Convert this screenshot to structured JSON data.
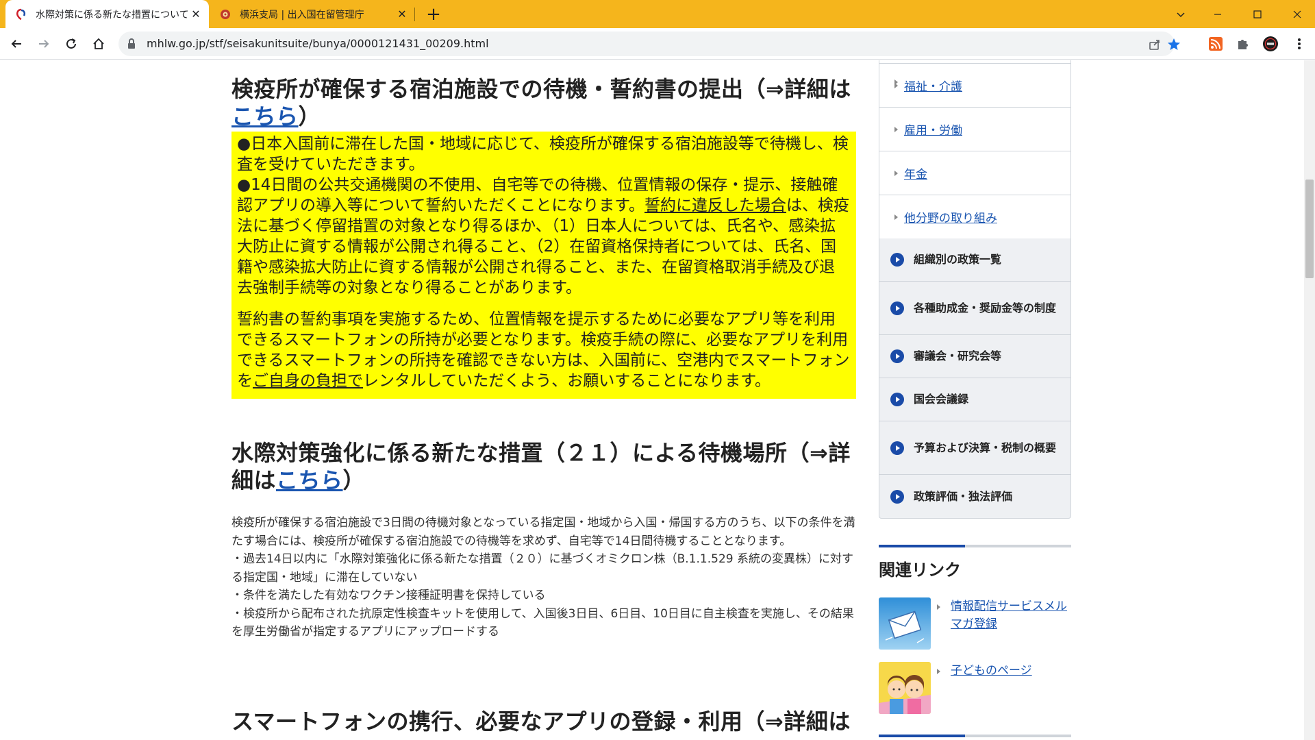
{
  "browser": {
    "tabs": [
      {
        "title": "水際対策に係る新たな措置について",
        "active": true
      },
      {
        "title": "横浜支局 | 出入国在留管理庁",
        "active": false
      }
    ],
    "close_glyph": "✕",
    "new_tab_glyph": "+",
    "url": "mhlw.go.jp/stf/seisakunitsuite/bunya/0000121431_00209.html",
    "accent_color": "#f5b51c"
  },
  "main": {
    "section1": {
      "heading": "検疫所が確保する宿泊施設での待機・誓約書の提出（⇒詳細は",
      "heading_link": "こちら",
      "heading_end": "）"
    },
    "yellow_box": {
      "p1": "●日本入国前に滞在した国・地域に応じて、検疫所が確保する宿泊施設等で待機し、検査を受けていただきます。",
      "p2_a": "●14日間の公共交通機関の不使用、自宅等での待機、位置情報の保存・提示、接触確認アプリの導入等について誓約いただくことになります。",
      "p2_u": "誓約に違反した場合",
      "p2_b": "は、検疫法に基づく停留措置の対象となり得るほか、（1）日本人については、氏名や、感染拡大防止に資する情報が公開され得ること、（2）在留資格保持者については、氏名、国籍や感染拡大防止に資する情報が公開され得ること、また、在留資格取消手続及び退去強制手続等の対象となり得ることがあります。",
      "p3_a": "誓約書の誓約事項を実施するため、位置情報を提示するために必要なアプリ等を利用できるスマートフォンの所持が必要となります。検疫手続の際に、必要なアプリを利用できるスマートフォンの所持を確認できない方は、入国前に、空港内でスマートフォンを",
      "p3_u": "ご自身の負担で",
      "p3_b": "レンタルしていただくよう、お願いすることになります。",
      "color": "#ffff00"
    },
    "section2": {
      "heading": "水際対策強化に係る新たな措置（２１）による待機場所（⇒詳細は",
      "heading_link": "こちら",
      "heading_end": "）",
      "body": [
        "検疫所が確保する宿泊施設で3日間の待機対象となっている指定国・地域から入国・帰国する方のうち、以下の条件を満たす場合には、検疫所が確保する宿泊施設での待機等を求めず、自宅等で14日間待機することとなります。",
        "・過去14日以内に「水際対策強化に係る新たな措置（２０）に基づくオミクロン株（B.1.1.529 系統の変異株）に対する指定国・地域」に滞在していない",
        "・条件を満たした有効なワクチン接種証明書を保持している",
        "・検疫所から配布された抗原定性検査キットを使用して、入国後3日目、6日目、10日目に自主検査を実施し、その結果を厚生労働省が指定するアプリにアップロードする"
      ]
    },
    "section3": {
      "heading": "スマートフォンの携行、必要なアプリの登録・利用（⇒詳細は"
    }
  },
  "sidebar": {
    "sub_items": [
      "福祉・介護",
      "雇用・労働",
      "年金",
      "他分野の取り組み"
    ],
    "categories": [
      "組織別の政策一覧",
      "各種助成金・奨励金等の制度",
      "審議会・研究会等",
      "国会会議録",
      "予算および決算・税制の概要",
      "政策評価・独法評価"
    ],
    "related_title": "関連リンク",
    "related": [
      {
        "label": "情報配信サービスメルマガ登録",
        "icon": "mail-envelope-icon"
      },
      {
        "label": "子どものページ",
        "icon": "children-icon"
      }
    ],
    "accent": "#1a4ba8"
  }
}
